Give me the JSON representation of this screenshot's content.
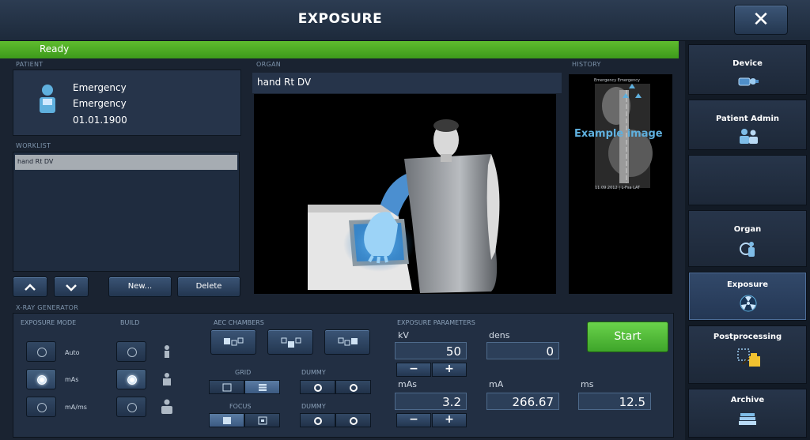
{
  "header": {
    "title": "EXPOSURE",
    "close_label": "✕"
  },
  "status": {
    "text": "Ready",
    "color": "#4caf2a"
  },
  "patient": {
    "section_label": "PATIENT",
    "line1": "Emergency",
    "line2": "Emergency",
    "birth_date": "01.01.1900"
  },
  "worklist": {
    "section_label": "WORKLIST",
    "items": [
      "hand Rt DV"
    ],
    "new_label": "New...",
    "delete_label": "Delete"
  },
  "organ": {
    "section_label": "ORGAN",
    "name": "hand Rt DV"
  },
  "history": {
    "section_label": "HISTORY",
    "thumb_header": "Emergency Emergency",
    "thumb_overlay": "Example image",
    "thumb_footer": "11.09.2012 | L-Fsa LAT"
  },
  "nav": {
    "items": [
      {
        "label": "Device",
        "icon": "device-icon",
        "active": false
      },
      {
        "label": "Patient Admin",
        "icon": "patient-admin-icon",
        "active": false
      },
      {
        "label": "",
        "icon": "",
        "active": false
      },
      {
        "label": "Organ",
        "icon": "organ-icon",
        "active": false
      },
      {
        "label": "Exposure",
        "icon": "radiation-icon",
        "active": true
      },
      {
        "label": "Postprocessing",
        "icon": "postprocessing-icon",
        "active": false
      },
      {
        "label": "Archive",
        "icon": "archive-icon",
        "active": false
      }
    ]
  },
  "generator": {
    "section_label": "X-RAY GENERATOR",
    "exposure_mode": {
      "label": "EXPOSURE MODE",
      "options": [
        "Auto",
        "mAs",
        "mA/ms"
      ],
      "selected": "mAs"
    },
    "build": {
      "label": "BUILD",
      "selected_index": 1
    },
    "aec": {
      "label": "AEC CHAMBERS"
    },
    "grid": {
      "label": "GRID"
    },
    "focus": {
      "label": "FOCUS"
    },
    "dummy1": {
      "label": "DUMMY"
    },
    "dummy2": {
      "label": "DUMMY"
    },
    "params": {
      "label": "EXPOSURE PARAMETERS",
      "kv_label": "kV",
      "kv_value": "50",
      "dens_label": "dens",
      "dens_value": "0",
      "mas_label": "mAs",
      "mas_value": "3.2",
      "ma_label": "mA",
      "ma_value": "266.67",
      "ms_label": "ms",
      "ms_value": "12.5",
      "minus": "−",
      "plus": "+"
    },
    "start_label": "Start",
    "start_color": "#52c03a"
  }
}
